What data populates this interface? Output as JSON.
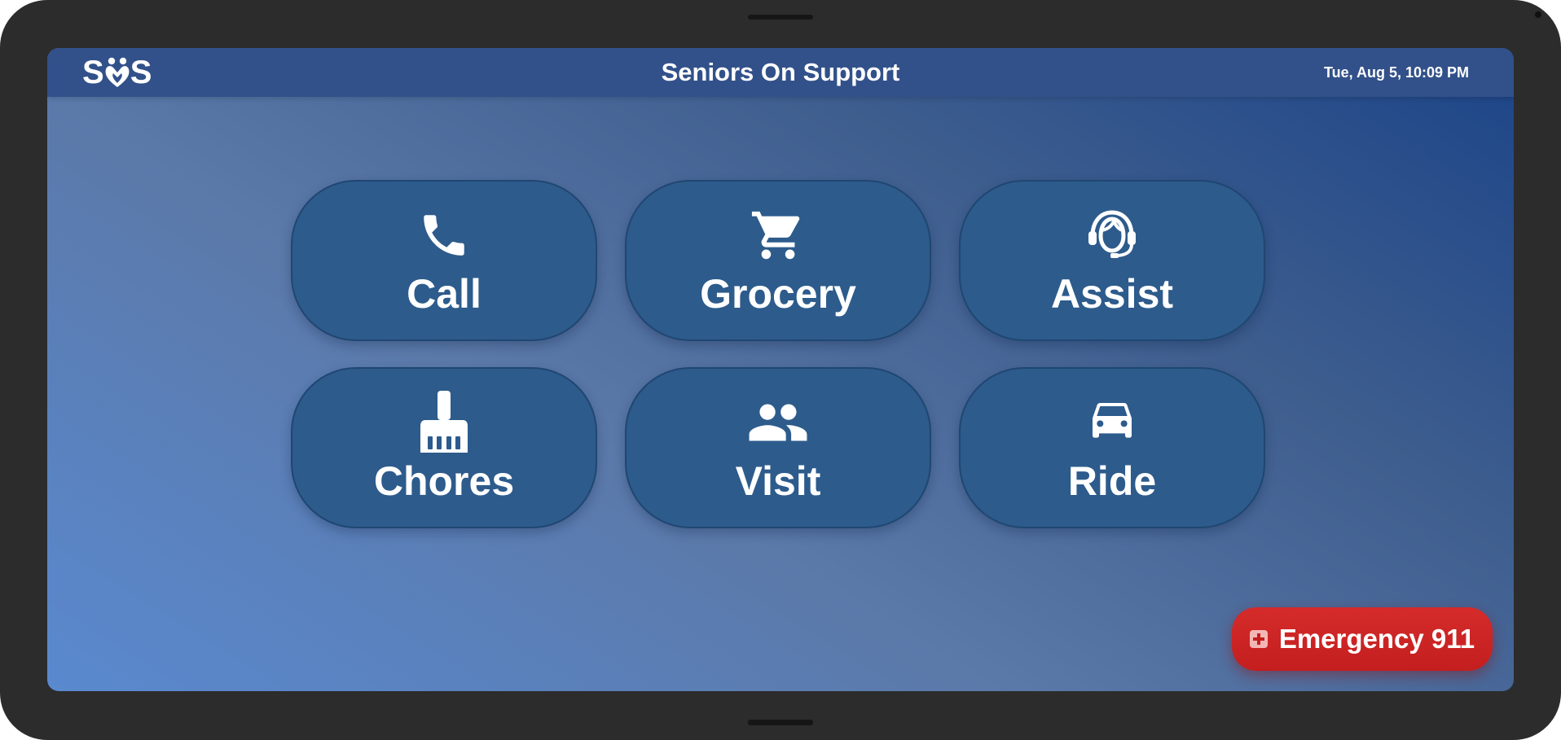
{
  "device": {
    "frame_color": "#2c2c2c"
  },
  "header": {
    "logo": {
      "letters_left": "S",
      "letters_right": "S",
      "mark_icon": "heart-people-icon"
    },
    "title": "Seniors On Support",
    "datetime": "Tue, Aug 5, 10:09 PM",
    "bar_color": "#32518a"
  },
  "tiles": [
    {
      "label": "Call",
      "icon": "phone-icon"
    },
    {
      "label": "Grocery",
      "icon": "shopping-cart-icon"
    },
    {
      "label": "Assist",
      "icon": "headset-agent-icon"
    },
    {
      "label": "Chores",
      "icon": "broom-icon"
    },
    {
      "label": "Visit",
      "icon": "people-icon"
    },
    {
      "label": "Ride",
      "icon": "car-icon"
    }
  ],
  "tile_color": "#2d5b8c",
  "emergency": {
    "label": "Emergency 911",
    "icon": "medical-cross-icon",
    "color": "#d52b2b"
  }
}
